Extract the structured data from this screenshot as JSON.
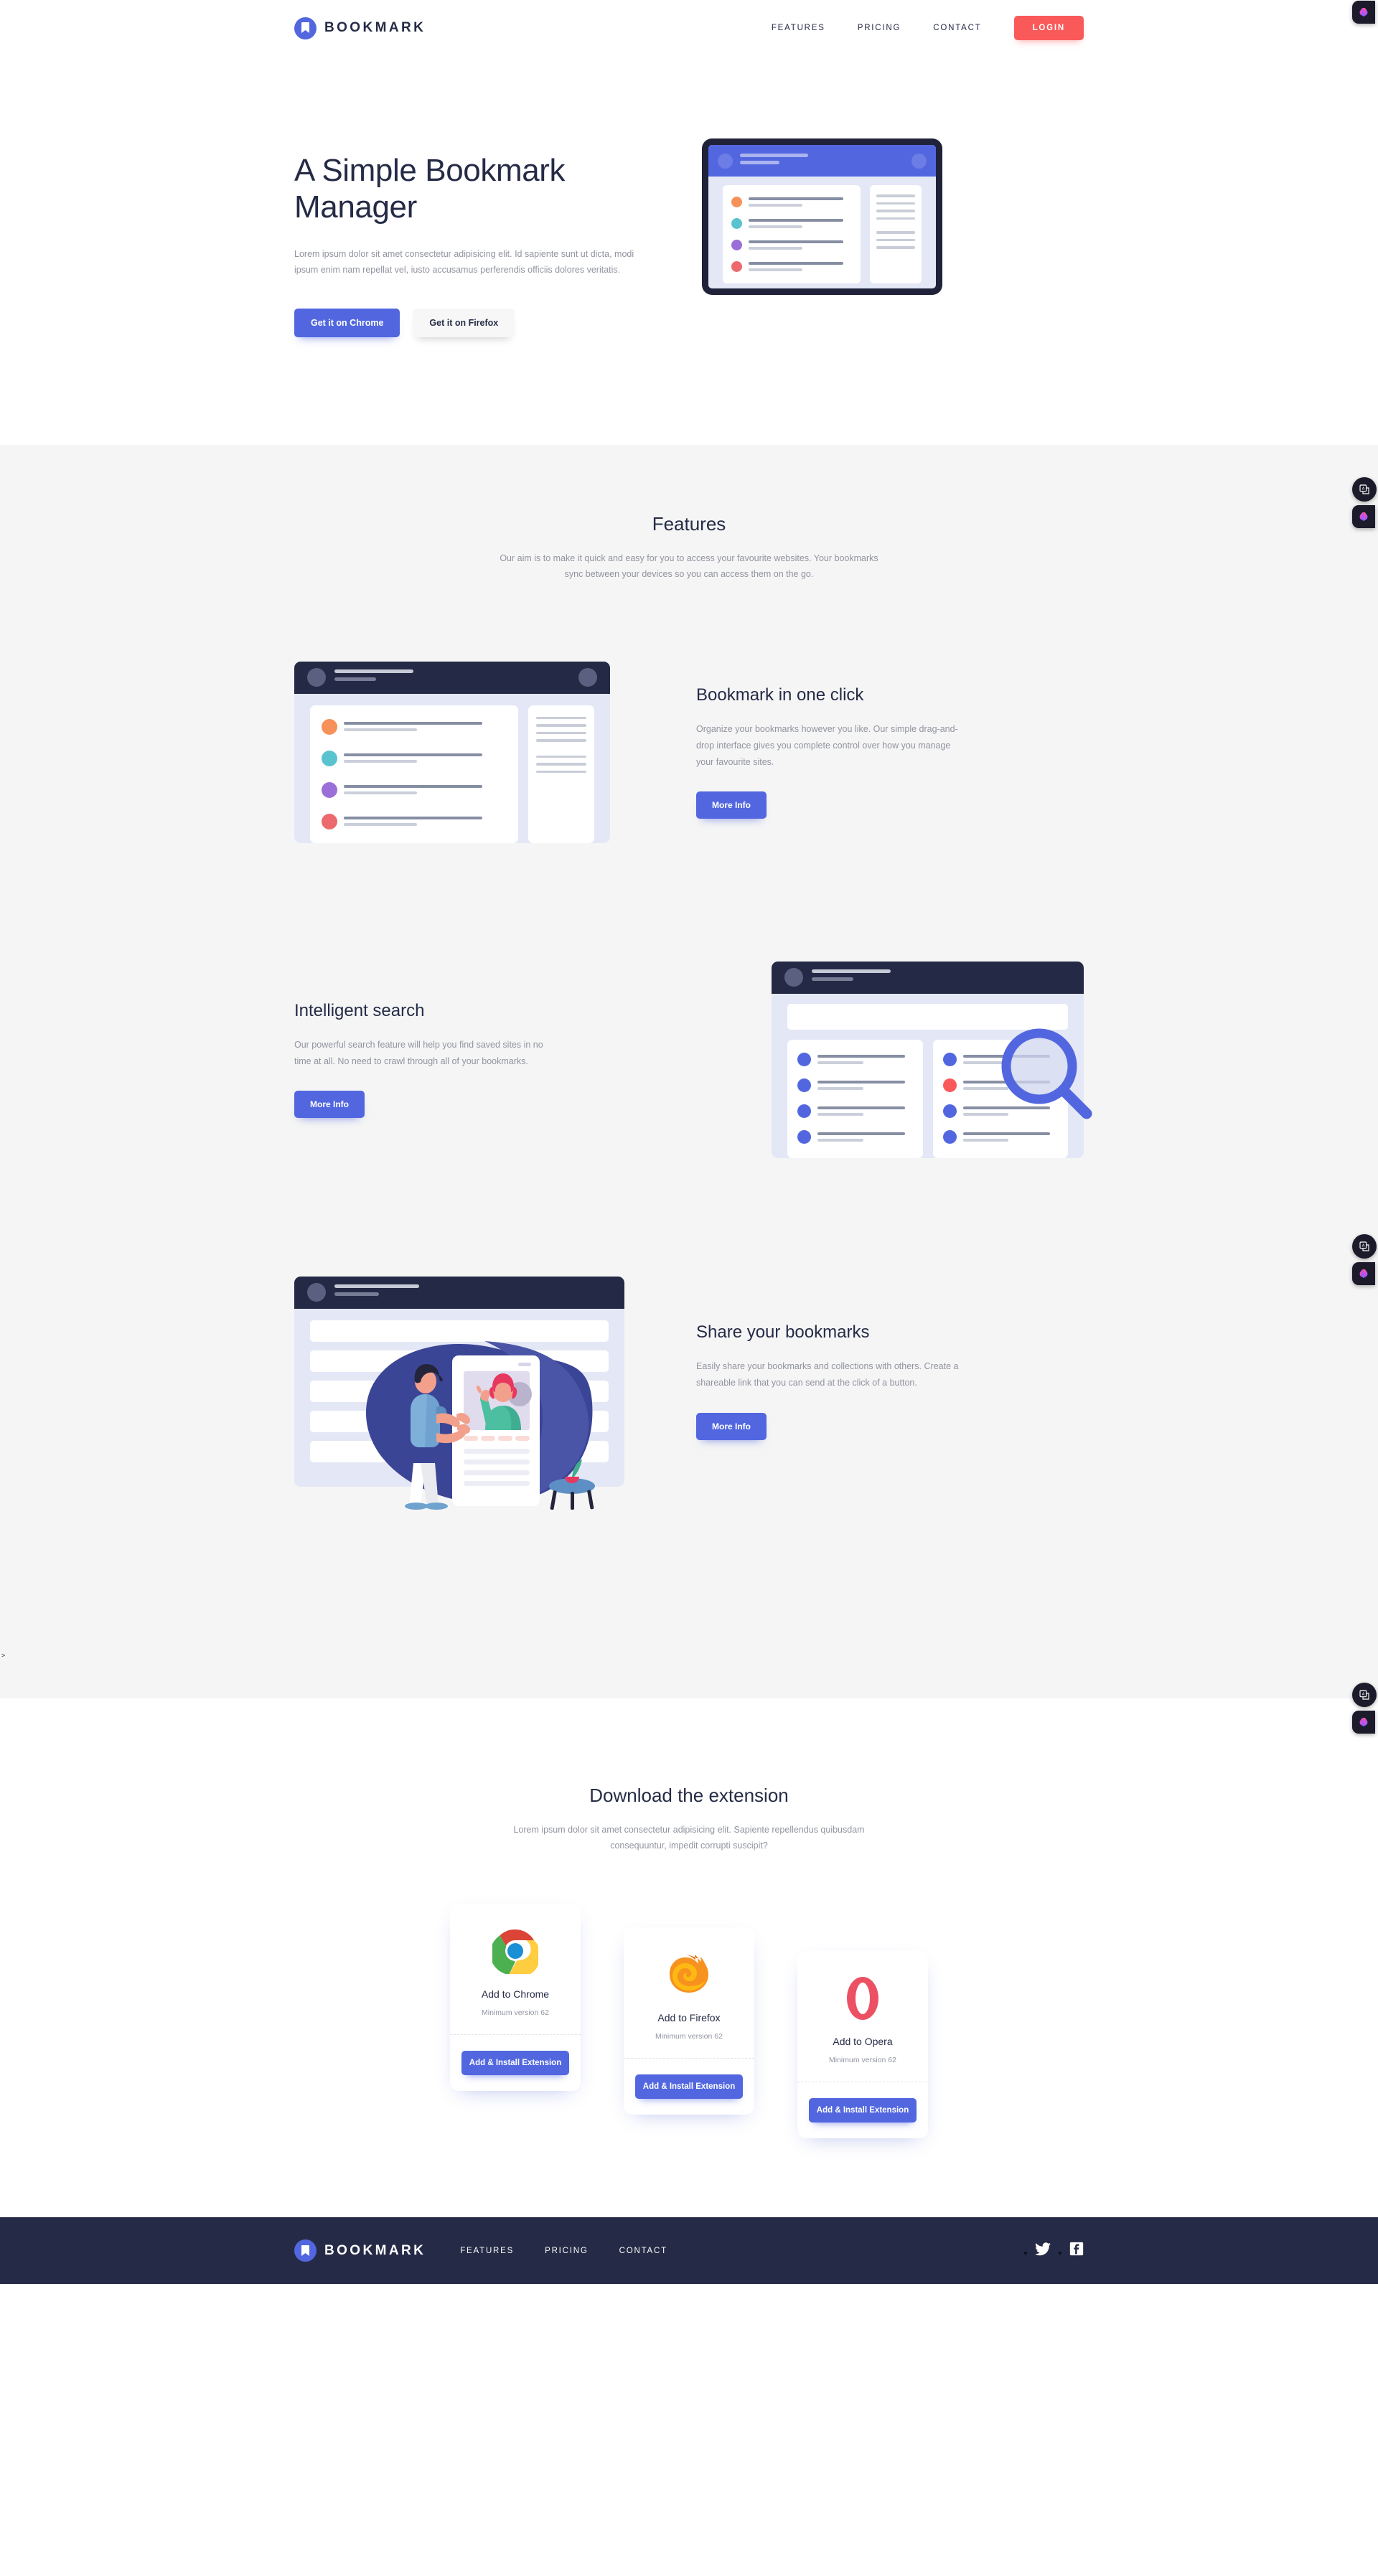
{
  "header": {
    "brand": "BOOKMARK",
    "nav": [
      {
        "label": "FEATURES"
      },
      {
        "label": "PRICING"
      },
      {
        "label": "CONTACT"
      }
    ],
    "login_label": "LOGIN",
    "login_color": "#FA5959"
  },
  "hero": {
    "title": "A Simple Bookmark Manager",
    "subtitle": "Lorem ipsum dolor sit amet consectetur adipisicing elit. Id sapiente sunt ut dicta, modi ipsum enim nam repellat vel, iusto accusamus perferendis officiis dolores veritatis.",
    "chrome_btn": "Get it on Chrome",
    "firefox_btn": "Get it on Firefox"
  },
  "features": {
    "title": "Features",
    "subtitle": "Our aim is to make it quick and easy for you to access your favourite websites. Your bookmarks sync between your devices so you can access them on the go.",
    "items": [
      {
        "title": "Bookmark in one click",
        "text": "Organize your bookmarks however you like. Our simple drag-and-drop interface gives you complete control over how you manage your favourite sites.",
        "button": "More Info"
      },
      {
        "title": "Intelligent search",
        "text": "Our powerful search feature will help you find saved sites in no time at all. No need to crawl through all of your bookmarks.",
        "button": "More Info"
      },
      {
        "title": "Share your bookmarks",
        "text": "Easily share your bookmarks and collections with others. Create a shareable link that you can send at the click of a button.",
        "button": "More Info"
      }
    ]
  },
  "download": {
    "title": "Download the extension",
    "subtitle": "Lorem ipsum dolor sit amet consectetur adipisicing elit. Sapiente repellendus quibusdam consequuntur, impedit corrupti suscipit?",
    "cards": [
      {
        "icon": "chrome-logo",
        "name": "Add to Chrome",
        "version": "Minimum version 62",
        "button": "Add & Install Extension"
      },
      {
        "icon": "firefox-logo",
        "name": "Add to Firefox",
        "version": "Minimum version 62",
        "button": "Add & Install Extension"
      },
      {
        "icon": "opera-logo",
        "name": "Add to Opera",
        "version": "Minimum version 62",
        "button": "Add & Install Extension"
      }
    ]
  },
  "footer": {
    "brand": "BOOKMARK",
    "nav": [
      {
        "label": "FEATURES"
      },
      {
        "label": "PRICING"
      },
      {
        "label": "CONTACT"
      }
    ],
    "social": [
      {
        "name": "twitter-icon"
      },
      {
        "name": "facebook-icon"
      }
    ],
    "background": "#252B46"
  },
  "floating_widgets": [
    {
      "name": "translate-widget"
    },
    {
      "name": "ai-brain-widget"
    }
  ],
  "stray_text": ">",
  "theme": {
    "primary": "#5267DF",
    "accent": "#FA5959",
    "dark": "#252B46",
    "muted": "#9194A1",
    "section_bg": "#F5F5F5"
  }
}
